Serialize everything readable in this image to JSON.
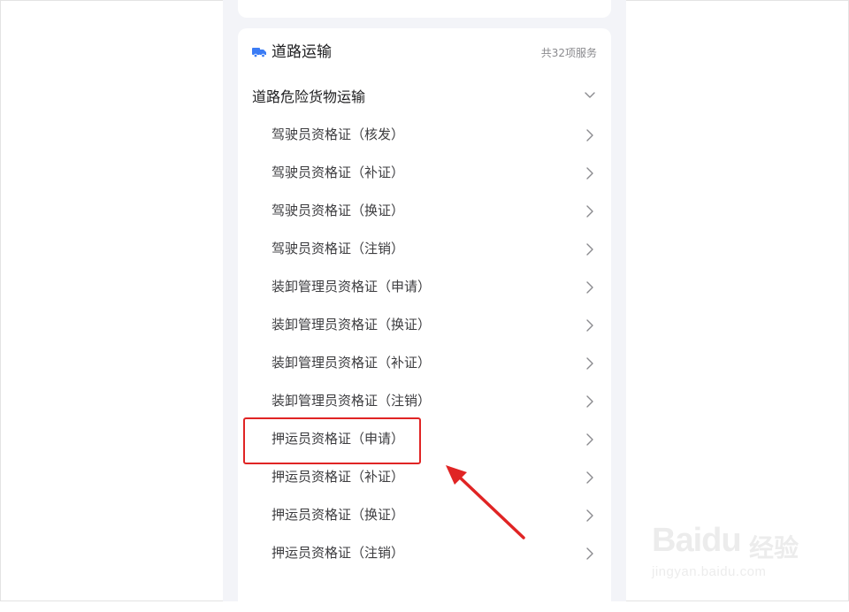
{
  "section": {
    "title": "道路运输",
    "count_label": "共32项服务",
    "icon": "truck-icon"
  },
  "category": {
    "label": "道路危险货物运输",
    "expanded": true
  },
  "items": [
    {
      "label": "驾驶员资格证（核发）"
    },
    {
      "label": "驾驶员资格证（补证）"
    },
    {
      "label": "驾驶员资格证（换证）"
    },
    {
      "label": "驾驶员资格证（注销）"
    },
    {
      "label": "装卸管理员资格证（申请）"
    },
    {
      "label": "装卸管理员资格证（换证）"
    },
    {
      "label": "装卸管理员资格证（补证）"
    },
    {
      "label": "装卸管理员资格证（注销）"
    },
    {
      "label": "押运员资格证（申请）"
    },
    {
      "label": "押运员资格证（补证）"
    },
    {
      "label": "押运员资格证（换证）"
    },
    {
      "label": "押运员资格证（注销）"
    }
  ],
  "annotation": {
    "highlight_color": "#e02424"
  },
  "watermark": {
    "brand": "Baidu",
    "product": "经验",
    "url": "jingyan.baidu.com"
  },
  "colors": {
    "accent": "#3b7cf5",
    "page_bg": "#f3f4f8",
    "card_bg": "#ffffff"
  }
}
